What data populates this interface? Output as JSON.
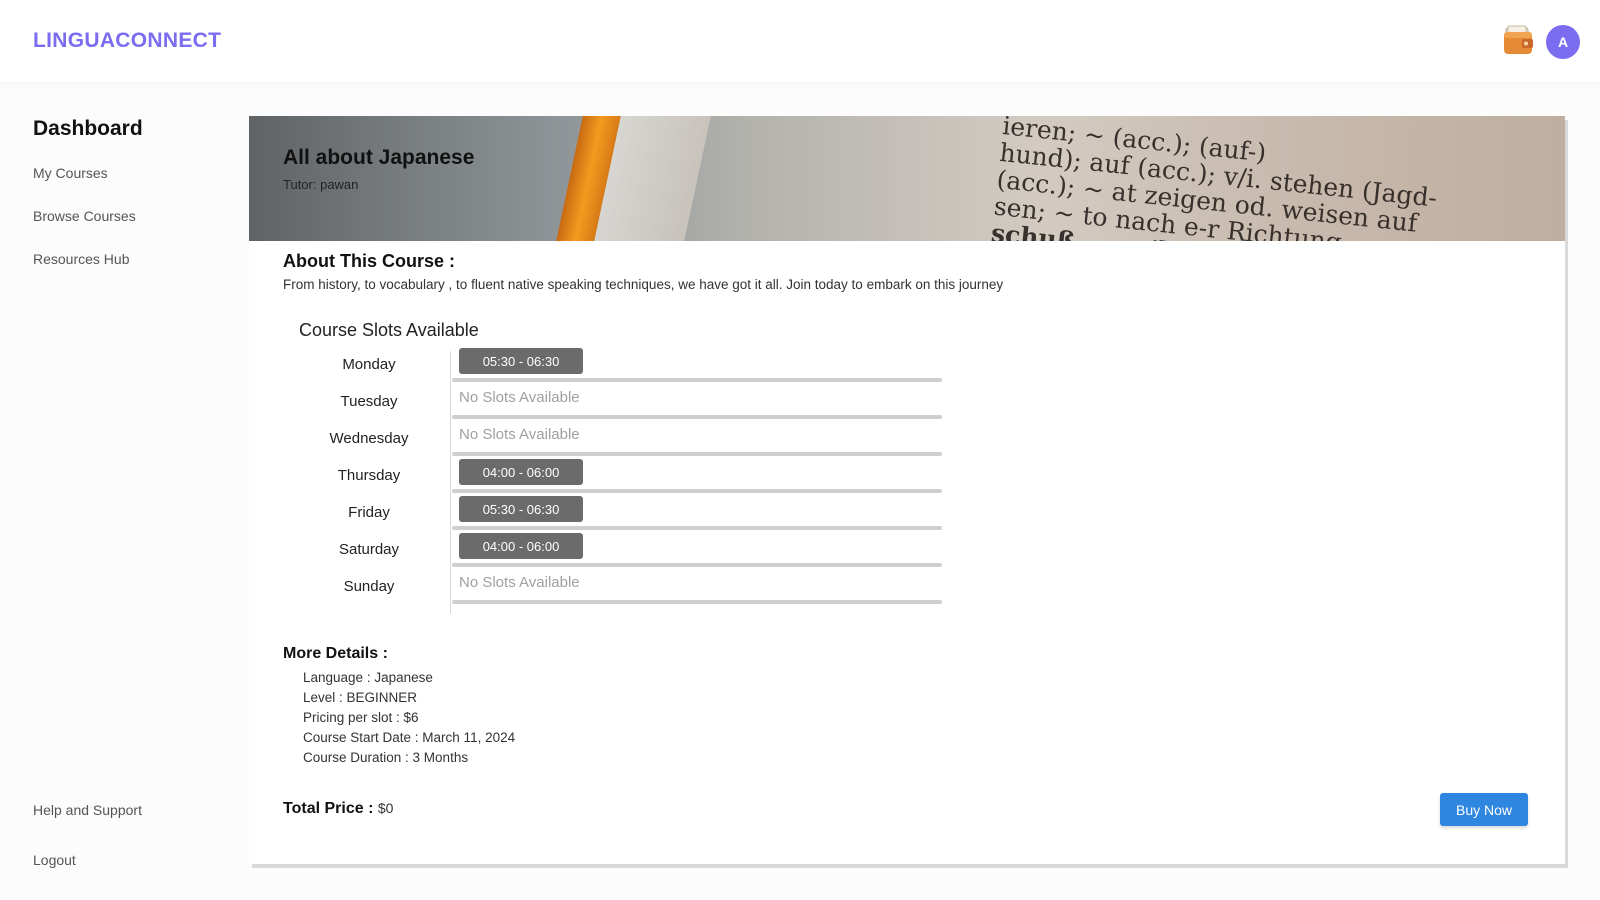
{
  "header": {
    "logo": "LINGUACONNECT",
    "avatar_initial": "A"
  },
  "sidebar": {
    "title": "Dashboard",
    "items": [
      {
        "label": "My Courses"
      },
      {
        "label": "Browse Courses"
      },
      {
        "label": "Resources Hub"
      }
    ],
    "bottom_items": [
      {
        "label": "Help and Support"
      },
      {
        "label": "Logout"
      }
    ]
  },
  "course": {
    "title": "All about Japanese",
    "tutor": "Tutor: pawan",
    "banner_text_lines": [
      "ieren; ~ (acc.); (auf-)",
      "hund); auf (acc.); v/i. stehen (Jagd-",
      "(acc.); ~ at zeigen od. weisen auf",
      "sen; ~ to nach e-r Richtung",
      "schuß...; ~-'blank"
    ],
    "about_heading": "About This Course :",
    "about_text": "From history, to vocabulary , to fluent native speaking techniques, we have got it all. Join today to embark on this journey"
  },
  "slots": {
    "heading": "Course Slots Available",
    "days": [
      {
        "day": "Monday",
        "slot": "05:30 - 06:30"
      },
      {
        "day": "Tuesday",
        "none": "No Slots Available"
      },
      {
        "day": "Wednesday",
        "none": "No Slots Available"
      },
      {
        "day": "Thursday",
        "slot": "04:00 - 06:00"
      },
      {
        "day": "Friday",
        "slot": "05:30 - 06:30"
      },
      {
        "day": "Saturday",
        "slot": "04:00 - 06:00"
      },
      {
        "day": "Sunday",
        "none": "No Slots Available"
      }
    ]
  },
  "details": {
    "heading": "More Details :",
    "lines": [
      "Language : Japanese",
      "Level : BEGINNER",
      "Pricing per slot : $6",
      "Course Start Date : March 11, 2024",
      "Course Duration : 3 Months"
    ]
  },
  "purchase": {
    "total_label": "Total Price :",
    "total_value": "$0",
    "buy_label": "Buy Now"
  },
  "colors": {
    "brand": "#7b6cf0",
    "buy_button": "#2f86e0",
    "slot_chip": "#6b6b6b"
  },
  "icons": {
    "wallet": "wallet-icon"
  }
}
